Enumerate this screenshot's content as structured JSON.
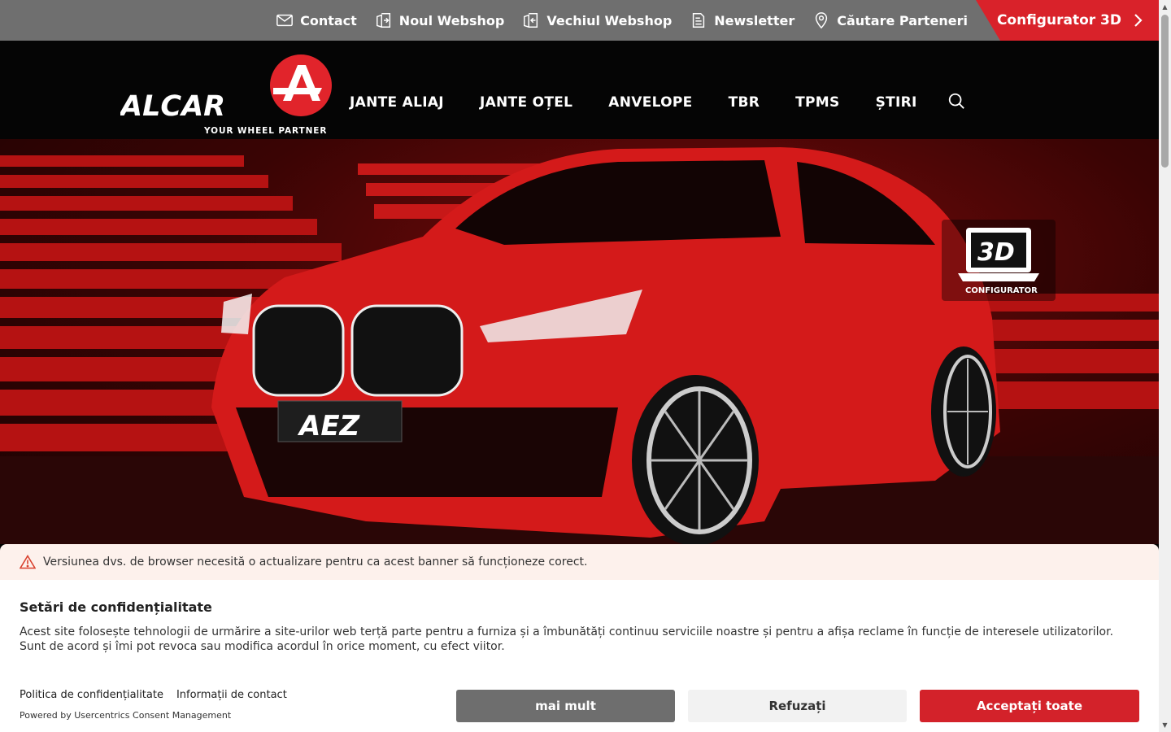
{
  "topbar": {
    "links": [
      {
        "label": "Contact",
        "icon": "mail-icon"
      },
      {
        "label": "Noul Webshop",
        "icon": "webshop-enter-icon"
      },
      {
        "label": "Vechiul Webshop",
        "icon": "webshop-exit-icon"
      },
      {
        "label": "Newsletter",
        "icon": "newsletter-icon"
      },
      {
        "label": "Căutare Parteneri",
        "icon": "location-pin-icon"
      }
    ],
    "configurator_label": "Configurator 3D"
  },
  "header": {
    "logo_text": "ALCAR",
    "logo_tagline": "YOUR WHEEL PARTNER",
    "nav": [
      "JANTE ALIAJ",
      "JANTE OȚEL",
      "ANVELOPE",
      "TBR",
      "TPMS",
      "ȘTIRI"
    ]
  },
  "hero": {
    "plate_text": "AEZ",
    "badge_top": "3D",
    "badge_bottom": "CONFIGURATOR"
  },
  "consent": {
    "warning": "Versiunea dvs. de browser necesită o actualizare pentru ca acest banner să funcționeze corect.",
    "title": "Setări de confidențialitate",
    "body": "Acest site folosește tehnologii de urmărire a site-urilor web terță parte pentru a furniza și a îmbunătăți continuu serviciile noastre și pentru a afișa reclame în funcție de interesele utilizatorilor. Sunt de acord și îmi pot revoca sau modifica acordul în orice moment, cu efect viitor.",
    "privacy_link": "Politica de confidențialitate",
    "contact_link": "Informații de contact",
    "powered": "Powered by Usercentrics Consent Management",
    "more_button": "mai mult",
    "refuse_button": "Refuzați",
    "accept_button": "Acceptați toate"
  },
  "colors": {
    "brand_red": "#d9222a",
    "topbar_gray": "#6f6f6f"
  }
}
